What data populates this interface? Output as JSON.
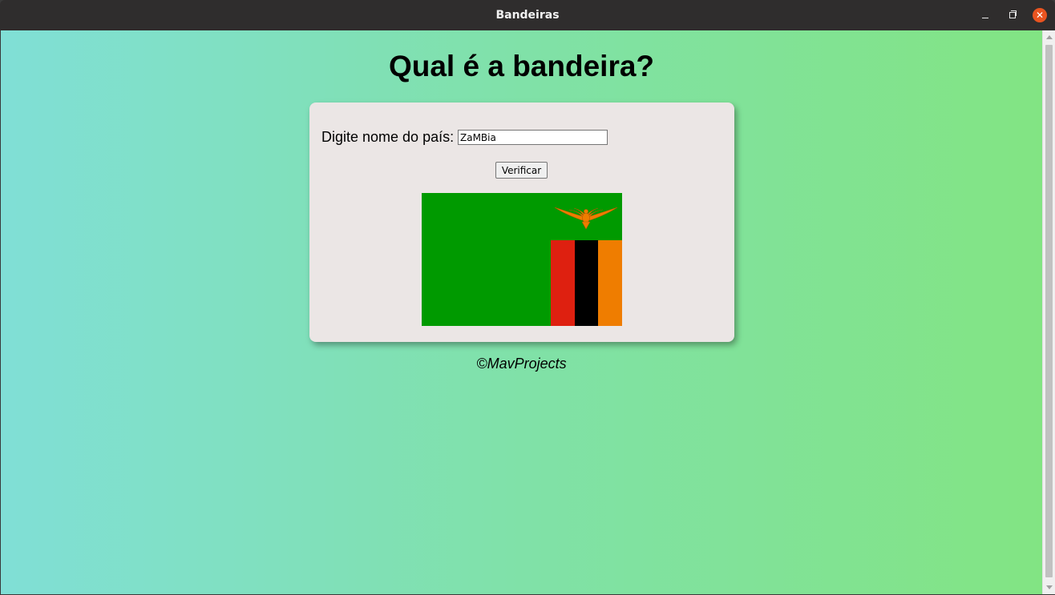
{
  "window": {
    "title": "Bandeiras",
    "minimize_glyph": "",
    "close_glyph": "✕"
  },
  "page": {
    "heading": "Qual é a bandeira?",
    "form": {
      "label": "Digite nome do país:",
      "input_value": "ZaMBia",
      "verify_label": "Verificar"
    },
    "flag": {
      "country": "Zambia",
      "colors": {
        "field": "#009a00",
        "red": "#de2010",
        "black": "#000000",
        "orange": "#ef7d00",
        "eagle": "#ef7d00"
      }
    },
    "footer": "©MavProjects"
  },
  "colors": {
    "gradient_start": "#80dfd6",
    "gradient_end": "#82e483",
    "card_background": "#ebe6e5",
    "titlebar": "#2f2d2d",
    "close_button": "#e95420"
  }
}
